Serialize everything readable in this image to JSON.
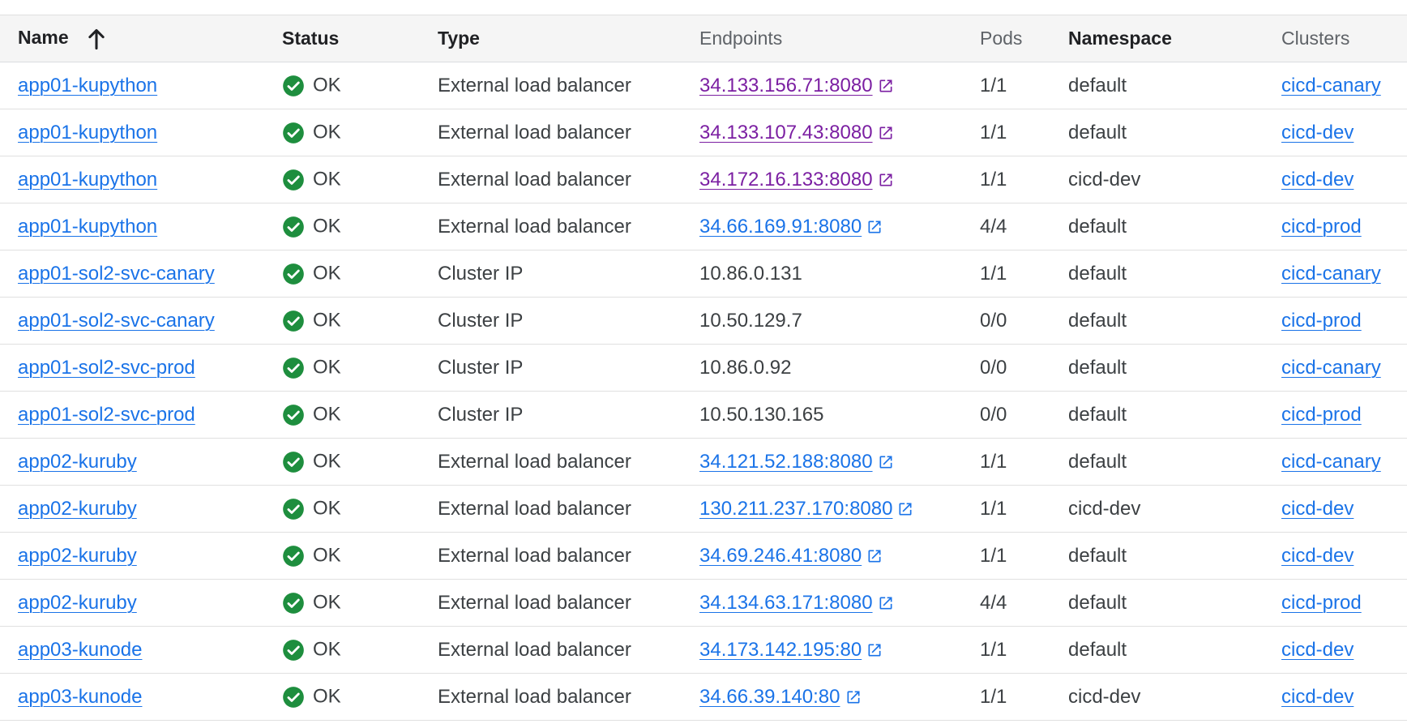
{
  "columns": {
    "name": "Name",
    "status": "Status",
    "type": "Type",
    "endpoints": "Endpoints",
    "pods": "Pods",
    "namespace": "Namespace",
    "clusters": "Clusters"
  },
  "colors": {
    "link": "#1a73e8",
    "visited_link": "#7b1fa2",
    "ok_green": "#1e8e3e",
    "header_bg": "#f5f5f5"
  },
  "rows": [
    {
      "name": "app01-kupython",
      "status": "OK",
      "type": "External load balancer",
      "endpoint": "34.133.156.71:8080",
      "endpoint_link": true,
      "visited": true,
      "pods": "1/1",
      "namespace": "default",
      "cluster": "cicd-canary"
    },
    {
      "name": "app01-kupython",
      "status": "OK",
      "type": "External load balancer",
      "endpoint": "34.133.107.43:8080",
      "endpoint_link": true,
      "visited": true,
      "pods": "1/1",
      "namespace": "default",
      "cluster": "cicd-dev"
    },
    {
      "name": "app01-kupython",
      "status": "OK",
      "type": "External load balancer",
      "endpoint": "34.172.16.133:8080",
      "endpoint_link": true,
      "visited": true,
      "pods": "1/1",
      "namespace": "cicd-dev",
      "cluster": "cicd-dev"
    },
    {
      "name": "app01-kupython",
      "status": "OK",
      "type": "External load balancer",
      "endpoint": "34.66.169.91:8080",
      "endpoint_link": true,
      "visited": false,
      "pods": "4/4",
      "namespace": "default",
      "cluster": "cicd-prod"
    },
    {
      "name": "app01-sol2-svc-canary",
      "status": "OK",
      "type": "Cluster IP",
      "endpoint": "10.86.0.131",
      "endpoint_link": false,
      "visited": false,
      "pods": "1/1",
      "namespace": "default",
      "cluster": "cicd-canary"
    },
    {
      "name": "app01-sol2-svc-canary",
      "status": "OK",
      "type": "Cluster IP",
      "endpoint": "10.50.129.7",
      "endpoint_link": false,
      "visited": false,
      "pods": "0/0",
      "namespace": "default",
      "cluster": "cicd-prod"
    },
    {
      "name": "app01-sol2-svc-prod",
      "status": "OK",
      "type": "Cluster IP",
      "endpoint": "10.86.0.92",
      "endpoint_link": false,
      "visited": false,
      "pods": "0/0",
      "namespace": "default",
      "cluster": "cicd-canary"
    },
    {
      "name": "app01-sol2-svc-prod",
      "status": "OK",
      "type": "Cluster IP",
      "endpoint": "10.50.130.165",
      "endpoint_link": false,
      "visited": false,
      "pods": "0/0",
      "namespace": "default",
      "cluster": "cicd-prod"
    },
    {
      "name": "app02-kuruby",
      "status": "OK",
      "type": "External load balancer",
      "endpoint": "34.121.52.188:8080",
      "endpoint_link": true,
      "visited": false,
      "pods": "1/1",
      "namespace": "default",
      "cluster": "cicd-canary"
    },
    {
      "name": "app02-kuruby",
      "status": "OK",
      "type": "External load balancer",
      "endpoint": "130.211.237.170:8080",
      "endpoint_link": true,
      "visited": false,
      "pods": "1/1",
      "namespace": "cicd-dev",
      "cluster": "cicd-dev"
    },
    {
      "name": "app02-kuruby",
      "status": "OK",
      "type": "External load balancer",
      "endpoint": "34.69.246.41:8080",
      "endpoint_link": true,
      "visited": false,
      "pods": "1/1",
      "namespace": "default",
      "cluster": "cicd-dev"
    },
    {
      "name": "app02-kuruby",
      "status": "OK",
      "type": "External load balancer",
      "endpoint": "34.134.63.171:8080",
      "endpoint_link": true,
      "visited": false,
      "pods": "4/4",
      "namespace": "default",
      "cluster": "cicd-prod"
    },
    {
      "name": "app03-kunode",
      "status": "OK",
      "type": "External load balancer",
      "endpoint": "34.173.142.195:80",
      "endpoint_link": true,
      "visited": false,
      "pods": "1/1",
      "namespace": "default",
      "cluster": "cicd-dev"
    },
    {
      "name": "app03-kunode",
      "status": "OK",
      "type": "External load balancer",
      "endpoint": "34.66.39.140:80",
      "endpoint_link": true,
      "visited": false,
      "pods": "1/1",
      "namespace": "cicd-dev",
      "cluster": "cicd-dev"
    }
  ]
}
